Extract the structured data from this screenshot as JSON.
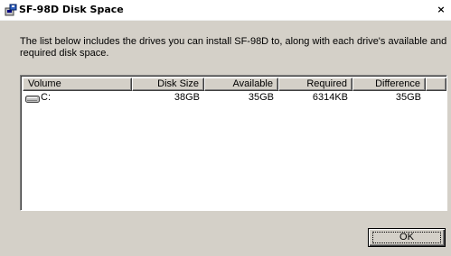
{
  "window": {
    "title": "SF-98D Disk Space",
    "close_label": "×"
  },
  "description": "The list below includes the drives you can install SF-98D to, along with each drive's available and required disk space.",
  "listview": {
    "columns": [
      "Volume",
      "Disk Size",
      "Available",
      "Required",
      "Difference"
    ],
    "rows": [
      {
        "volume": "C:",
        "disk_size": "38GB",
        "available": "35GB",
        "required": "6314KB",
        "difference": "35GB",
        "icon": "hard-drive-icon"
      }
    ]
  },
  "buttons": {
    "ok_label": "OK"
  },
  "colors": {
    "dialog_background": "#d4d0c8",
    "title_background": "#ffffff",
    "list_background": "#ffffff"
  }
}
